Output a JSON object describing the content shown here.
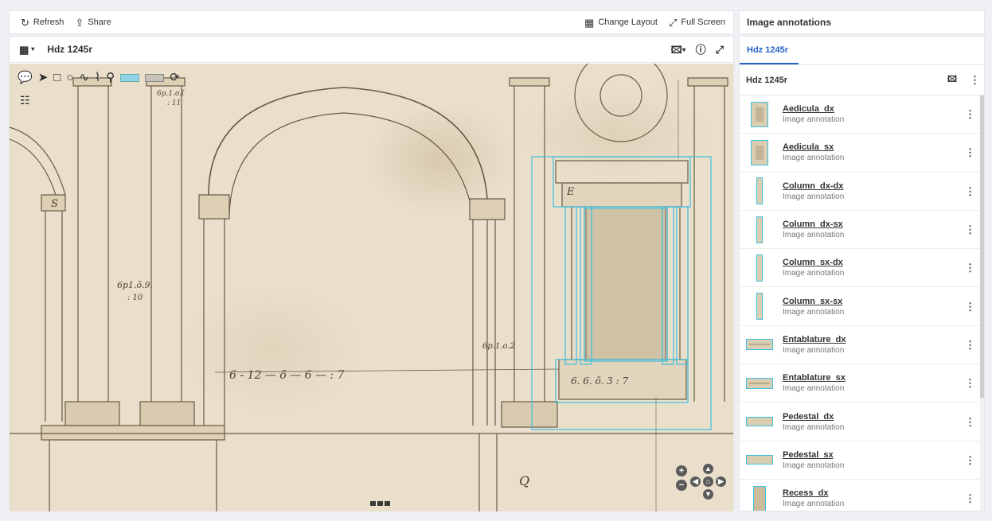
{
  "toolbar": {
    "refresh_label": "Refresh",
    "share_label": "Share",
    "change_layout_label": "Change Layout",
    "full_screen_label": "Full Screen"
  },
  "viewer": {
    "title": "Hdz 1245r",
    "handwriting": {
      "dim_main": "6 - 12 — õ — 6 — : 7",
      "dim_left": "6p1.õ.9.",
      "dim_left_sub": ": 10",
      "dim_top": "6p.1.o.ĩ",
      "dim_top_sub": ": 11",
      "dim_mid": "6p.1.o.2",
      "dim_niche": "6. 6. õ. 3 : 7",
      "label_s": "S",
      "label_e": "E",
      "label_q": "Q"
    }
  },
  "panel": {
    "title": "Image annotations",
    "tab_label": "Hdz 1245r",
    "list_header": "Hdz 1245r",
    "items": [
      {
        "name": "Aedicula_dx",
        "type": "Image annotation"
      },
      {
        "name": "Aedicula_sx",
        "type": "Image annotation"
      },
      {
        "name": "Column_dx-dx",
        "type": "Image annotation"
      },
      {
        "name": "Column_dx-sx",
        "type": "Image annotation"
      },
      {
        "name": "Column_sx-dx",
        "type": "Image annotation"
      },
      {
        "name": "Column_sx-sx",
        "type": "Image annotation"
      },
      {
        "name": "Entablature_dx",
        "type": "Image annotation"
      },
      {
        "name": "Entablature_sx",
        "type": "Image annotation"
      },
      {
        "name": "Pedestal_dx",
        "type": "Image annotation"
      },
      {
        "name": "Pedestal_sx",
        "type": "Image annotation"
      },
      {
        "name": "Recess_dx",
        "type": "Image annotation"
      }
    ]
  },
  "colors": {
    "accent": "#2563c9",
    "annotation": "#3ec0e0",
    "paper": "#e9dfcb",
    "ink": "#6b5a45"
  }
}
